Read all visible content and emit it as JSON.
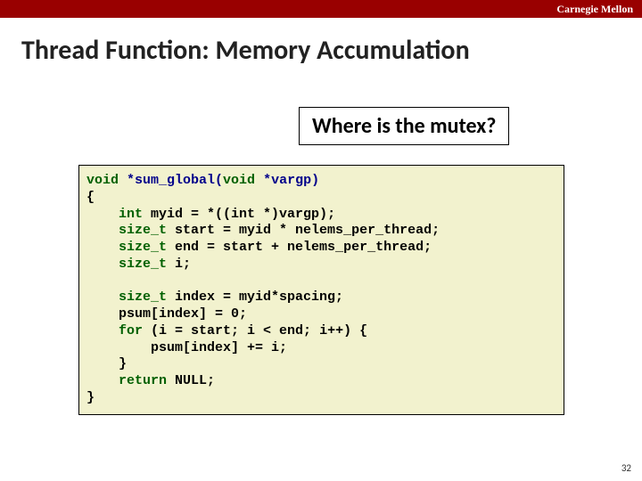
{
  "header": {
    "brand": "Carnegie Mellon"
  },
  "slide": {
    "title": "Thread Function: Memory Accumulation",
    "callout": "Where is the mutex?",
    "page_number": "32"
  },
  "code": {
    "l01_kw1": "void",
    "l01_fn": " *sum_global(",
    "l01_kw2": "void",
    "l01_rest": " *vargp)",
    "l02": "{",
    "l03_indent": "    ",
    "l03_kw": "int",
    "l03_rest": " myid = *((int *)vargp);",
    "l04_indent": "    ",
    "l04_kw": "size_t",
    "l04_rest": " start = myid * nelems_per_thread;",
    "l05_indent": "    ",
    "l05_kw": "size_t",
    "l05_rest": " end = start + nelems_per_thread;",
    "l06_indent": "    ",
    "l06_kw": "size_t",
    "l06_rest": " i;",
    "l07": " ",
    "l08_indent": "    ",
    "l08_kw": "size_t",
    "l08_rest": " index = myid*spacing;",
    "l09": "    psum[index] = 0;",
    "l10_indent": "    ",
    "l10_kw": "for",
    "l10_rest": " (i = start; i < end; i++) {",
    "l11": "        psum[index] += i;",
    "l12": "    }",
    "l13_indent": "    ",
    "l13_kw": "return",
    "l13_rest": " NULL;",
    "l14": "}"
  }
}
